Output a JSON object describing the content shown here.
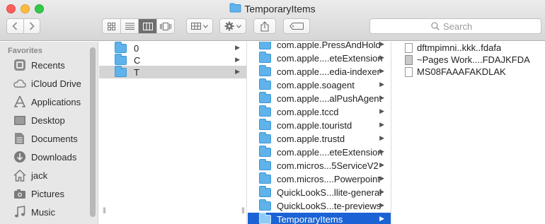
{
  "window": {
    "title": "TemporaryItems"
  },
  "toolbar": {
    "search_placeholder": "Search",
    "view_modes": [
      "icon",
      "list",
      "column",
      "cover-flow"
    ],
    "active_view": "column"
  },
  "sidebar": {
    "heading": "Favorites",
    "items": [
      {
        "label": "Recents",
        "icon": "recents-icon"
      },
      {
        "label": "iCloud Drive",
        "icon": "cloud-icon"
      },
      {
        "label": "Applications",
        "icon": "applications-icon"
      },
      {
        "label": "Desktop",
        "icon": "desktop-icon"
      },
      {
        "label": "Documents",
        "icon": "documents-icon"
      },
      {
        "label": "Downloads",
        "icon": "downloads-icon"
      },
      {
        "label": "jack",
        "icon": "home-icon"
      },
      {
        "label": "Pictures",
        "icon": "pictures-icon"
      },
      {
        "label": "Music",
        "icon": "music-icon"
      }
    ]
  },
  "column1": {
    "items": [
      {
        "label": "0",
        "selected": false
      },
      {
        "label": "C",
        "selected": false
      },
      {
        "label": "T",
        "selected": true
      }
    ]
  },
  "column2": {
    "items": [
      {
        "label": "com.apple.PressAndHold"
      },
      {
        "label": "com.apple....eteExtension"
      },
      {
        "label": "com.apple....edia-indexer"
      },
      {
        "label": "com.apple.soagent"
      },
      {
        "label": "com.apple....alPushAgent"
      },
      {
        "label": "com.apple.tccd"
      },
      {
        "label": "com.apple.touristd"
      },
      {
        "label": "com.apple.trustd"
      },
      {
        "label": "com.apple....eteExtension"
      },
      {
        "label": "com.micros...5ServiceV2"
      },
      {
        "label": "com.micros....Powerpoint"
      },
      {
        "label": "QuickLookS...llite-general"
      },
      {
        "label": "QuickLookS...te-previews"
      },
      {
        "label": "TemporaryItems",
        "selected": true
      }
    ]
  },
  "column3": {
    "items": [
      {
        "label": "dftmpimni..kkk..fdafa",
        "icon": "document-icon"
      },
      {
        "label": "~Pages Work....FDAJKFDA",
        "icon": "pages-document-icon"
      },
      {
        "label": "MS08FAAAFAKDLAK",
        "icon": "document-icon"
      }
    ]
  },
  "colors": {
    "selection_blue": "#1b63d4",
    "selection_gray": "#d4d4d4",
    "folder_blue": "#5fb3ea"
  }
}
